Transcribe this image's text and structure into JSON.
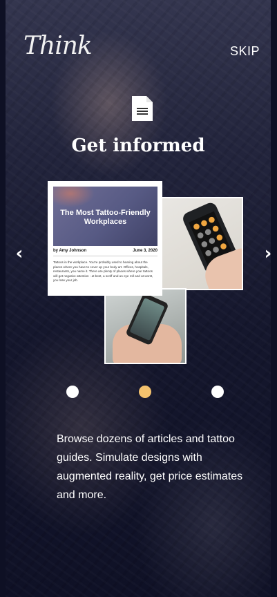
{
  "app": {
    "logo_text": "Think",
    "skip_label": "SKIP"
  },
  "slide": {
    "title": "Get informed",
    "icon": "document-icon",
    "description": "Browse dozens of articles and tattoo guides. Simulate designs with augmented reality, get price estimates and more."
  },
  "article_card": {
    "title": "The Most Tattoo-Friendly Workplaces",
    "author": "by Amy Johnson",
    "date": "June 3, 2020",
    "excerpt": "Tattoos in the workplace. You're probably used to hearing about the places where you have to cover up your body art. Offices, hospitals, restaurants, you name it. There are plenty of places where your tattoos will get negative attention - at best, a scoff and an eye roll and at worst, you lose your job."
  },
  "pagination": {
    "count": 3,
    "active_index": 1
  },
  "colors": {
    "accent": "#f4c26e",
    "background": "#15172d",
    "text": "#ffffff"
  },
  "icons": {
    "prev": "chevron-left-icon",
    "next": "chevron-right-icon"
  }
}
